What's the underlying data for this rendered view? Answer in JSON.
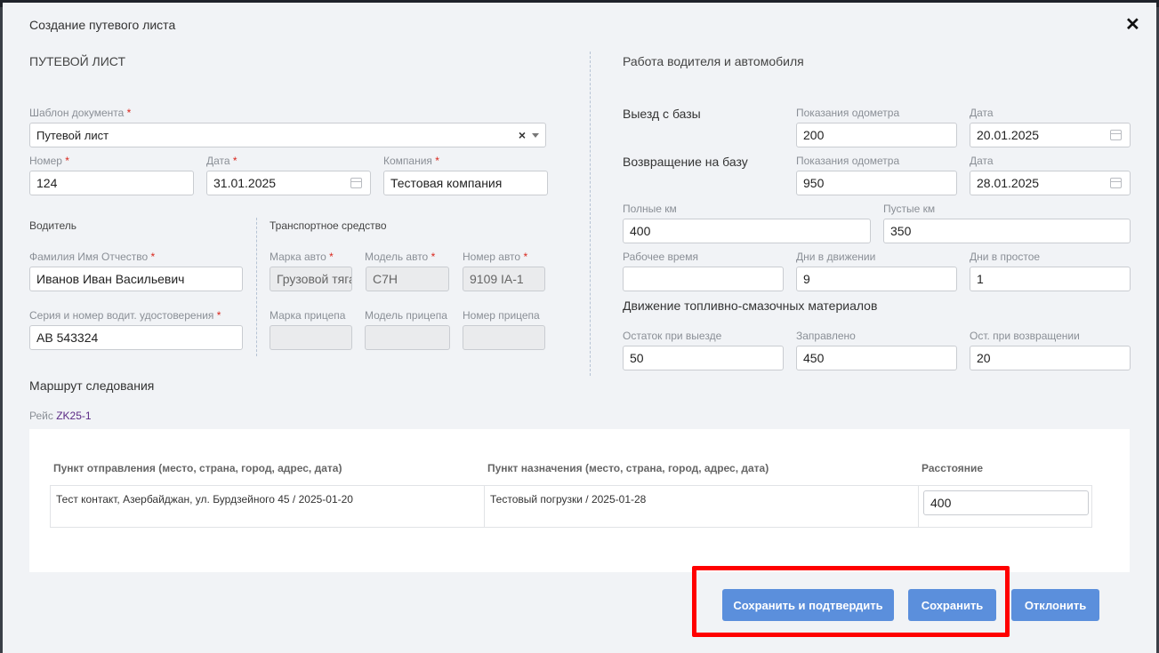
{
  "modal": {
    "title": "Создание путевого листа"
  },
  "left": {
    "section_title": "ПУТЕВОЙ ЛИСТ",
    "template": {
      "label": "Шаблон документа",
      "value": "Путевой лист"
    },
    "number": {
      "label": "Номер",
      "value": "124"
    },
    "date": {
      "label": "Дата",
      "value": "31.01.2025"
    },
    "company": {
      "label": "Компания",
      "value": "Тестовая компания"
    },
    "driver": {
      "title": "Водитель",
      "fio_label": "Фамилия Имя Отчество",
      "fio_value": "Иванов Иван Васильевич",
      "license_label": "Серия и номер водит. удостоверения",
      "license_value": "AB 543324"
    },
    "vehicle": {
      "title": "Транспортное средство",
      "brand_label": "Марка авто",
      "brand_value": "Грузовой тягач",
      "model_label": "Модель авто",
      "model_value": "C7H",
      "number_label": "Номер авто",
      "number_value": "9109 IA-1",
      "trailer_brand_label": "Марка прицепа",
      "trailer_brand_value": "",
      "trailer_model_label": "Модель прицепа",
      "trailer_model_value": "",
      "trailer_number_label": "Номер прицепа",
      "trailer_number_value": ""
    }
  },
  "right": {
    "section_title": "Работа водителя и автомобиля",
    "departure": {
      "title": "Выезд с базы",
      "odometer_label": "Показания одометра",
      "odometer_value": "200",
      "date_label": "Дата",
      "date_value": "20.01.2025"
    },
    "return": {
      "title": "Возвращение на базу",
      "odometer_label": "Показания одометра",
      "odometer_value": "950",
      "date_label": "Дата",
      "date_value": "28.01.2025"
    },
    "full_km": {
      "label": "Полные км",
      "value": "400"
    },
    "empty_km": {
      "label": "Пустые км",
      "value": "350"
    },
    "work_time": {
      "label": "Рабочее время",
      "value": ""
    },
    "days_moving": {
      "label": "Дни в движении",
      "value": "9"
    },
    "days_idle": {
      "label": "Дни в простое",
      "value": "1"
    },
    "fuel": {
      "title": "Движение топливно-смазочных материалов",
      "remain_label": "Остаток при выезде",
      "remain_value": "50",
      "filled_label": "Заправлено",
      "filled_value": "450",
      "return_label": "Ост. при возвращении",
      "return_value": "20"
    }
  },
  "route": {
    "title": "Маршрут следования",
    "trip_label": "Рейс",
    "trip_value": "ZK25-1",
    "headers": [
      "Пункт отправления (место, страна, город, адрес, дата)",
      "Пункт назначения (место, страна, город, адрес, дата)",
      "Расстояние"
    ],
    "row": {
      "from": "Тест контакт, Азербайджан, ул. Бурдзейного 45 / 2025-01-20",
      "to": "Тестовый погрузки / 2025-01-28",
      "distance": "400"
    }
  },
  "buttons": {
    "save_confirm": "Сохранить и подтвердить",
    "save": "Сохранить",
    "reject": "Отклонить"
  },
  "colors": {
    "primary_button": "#5b8fdc",
    "highlight": "#ff0000",
    "required": "#d9261c"
  }
}
